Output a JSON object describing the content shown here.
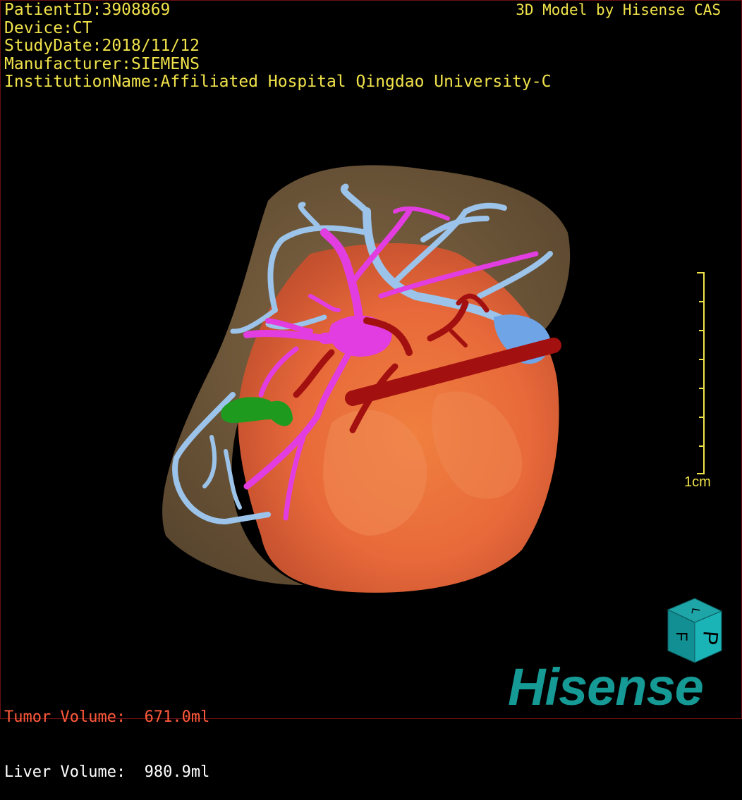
{
  "header": {
    "patient_id": "PatientID:3908869",
    "device": "Device:CT",
    "study_date": "StudyDate:2018/11/12",
    "manufacturer": "Manufacturer:SIEMENS",
    "institution": "InstitutionName:Affiliated Hospital Qingdao University-C"
  },
  "brand": {
    "model_credit": "3D Model by Hisense CAS",
    "logo": "Hisense"
  },
  "volumes": {
    "tumor": "Tumor Volume:  671.0ml",
    "liver": "Liver Volume:  980.9ml"
  },
  "scale": {
    "label": "1cm"
  },
  "orientation_cube": {
    "face_top": "L",
    "face_front": "P",
    "face_side": "F"
  },
  "colors": {
    "liver": "#7a6142",
    "tumor": "#e5673a",
    "portal_vein": "#e23de0",
    "hepatic_vein": "#9cc3ea",
    "artery": "#a31010",
    "gallbladder": "#1e9a1e",
    "text": "#f0e24a",
    "logo": "#159a96"
  }
}
